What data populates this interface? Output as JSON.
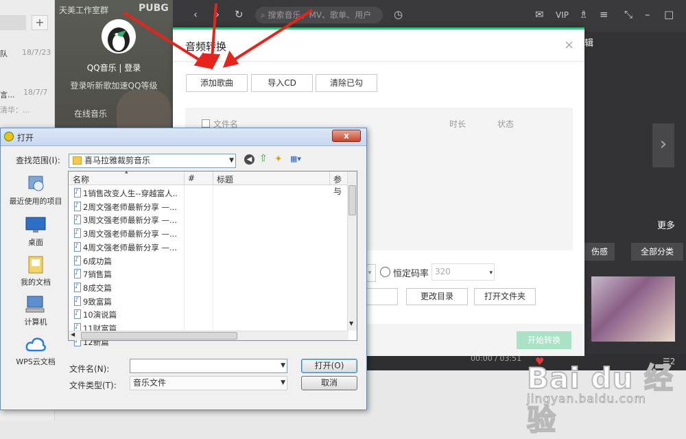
{
  "chat": {
    "plus": "+",
    "rows": [
      {
        "name": "队",
        "date": "18/7/23",
        "sub": ""
      },
      {
        "name": "言...",
        "date": "18/7/7",
        "sub": "清华：..."
      }
    ]
  },
  "qq": {
    "brand": "天美工作室群",
    "pubg": "PUBG",
    "login": "QQ音乐 | 登录",
    "login_sub": "登录听新歌加速QQ等级",
    "online": "在线音乐",
    "search_placeholder": "搜索音乐、MV、歌单、用户",
    "vip": "VIP",
    "album_hint": "辑",
    "more": "更多",
    "tags": [
      "伤感",
      "全部分类"
    ],
    "player_time": "00:00 / 03:51",
    "accent": "#31c27c"
  },
  "convert": {
    "title": "音频转换",
    "close": "×",
    "buttons": [
      "添加歌曲",
      "导入CD",
      "清除已勾"
    ],
    "columns": {
      "file": "文件名",
      "duration": "时长",
      "status": "状态"
    },
    "bitrate_label": "恒定码率",
    "bitrate_value": "320",
    "change_dir": "更改目录",
    "open_folder": "打开文件夹",
    "start": "开始转换"
  },
  "open_dialog": {
    "title": "打开",
    "look_in_label": "查找范围(I):",
    "look_in_value": "喜马拉雅裁剪音乐",
    "places": [
      {
        "label": "最近使用的项目",
        "icon": "recent-icon"
      },
      {
        "label": "桌面",
        "icon": "desktop-icon"
      },
      {
        "label": "我的文档",
        "icon": "documents-icon"
      },
      {
        "label": "计算机",
        "icon": "computer-icon"
      },
      {
        "label": "WPS云文档",
        "icon": "cloud-icon"
      }
    ],
    "columns": [
      "名称",
      "#",
      "标题",
      "参与"
    ],
    "files": [
      "1销售改变人生--穿越富人...",
      "2周文强老师最新分享 —...",
      "3周文强老师最新分享 —...",
      "3周文强老师最新分享 —...",
      "4周文强老师最新分享 —...",
      "6成功篇",
      "7销售篇",
      "8成交篇",
      "9致富篇",
      "10演说篇",
      "11财富篇",
      "12新篇"
    ],
    "filename_label": "文件名(N):",
    "filename_value": "",
    "filetype_label": "文件类型(T):",
    "filetype_value": "音乐文件",
    "open_button": "打开(O)",
    "cancel_button": "取消",
    "close": "x"
  },
  "watermark": {
    "big": "Bai du 经验",
    "small": "jingyan.baidu.com"
  }
}
